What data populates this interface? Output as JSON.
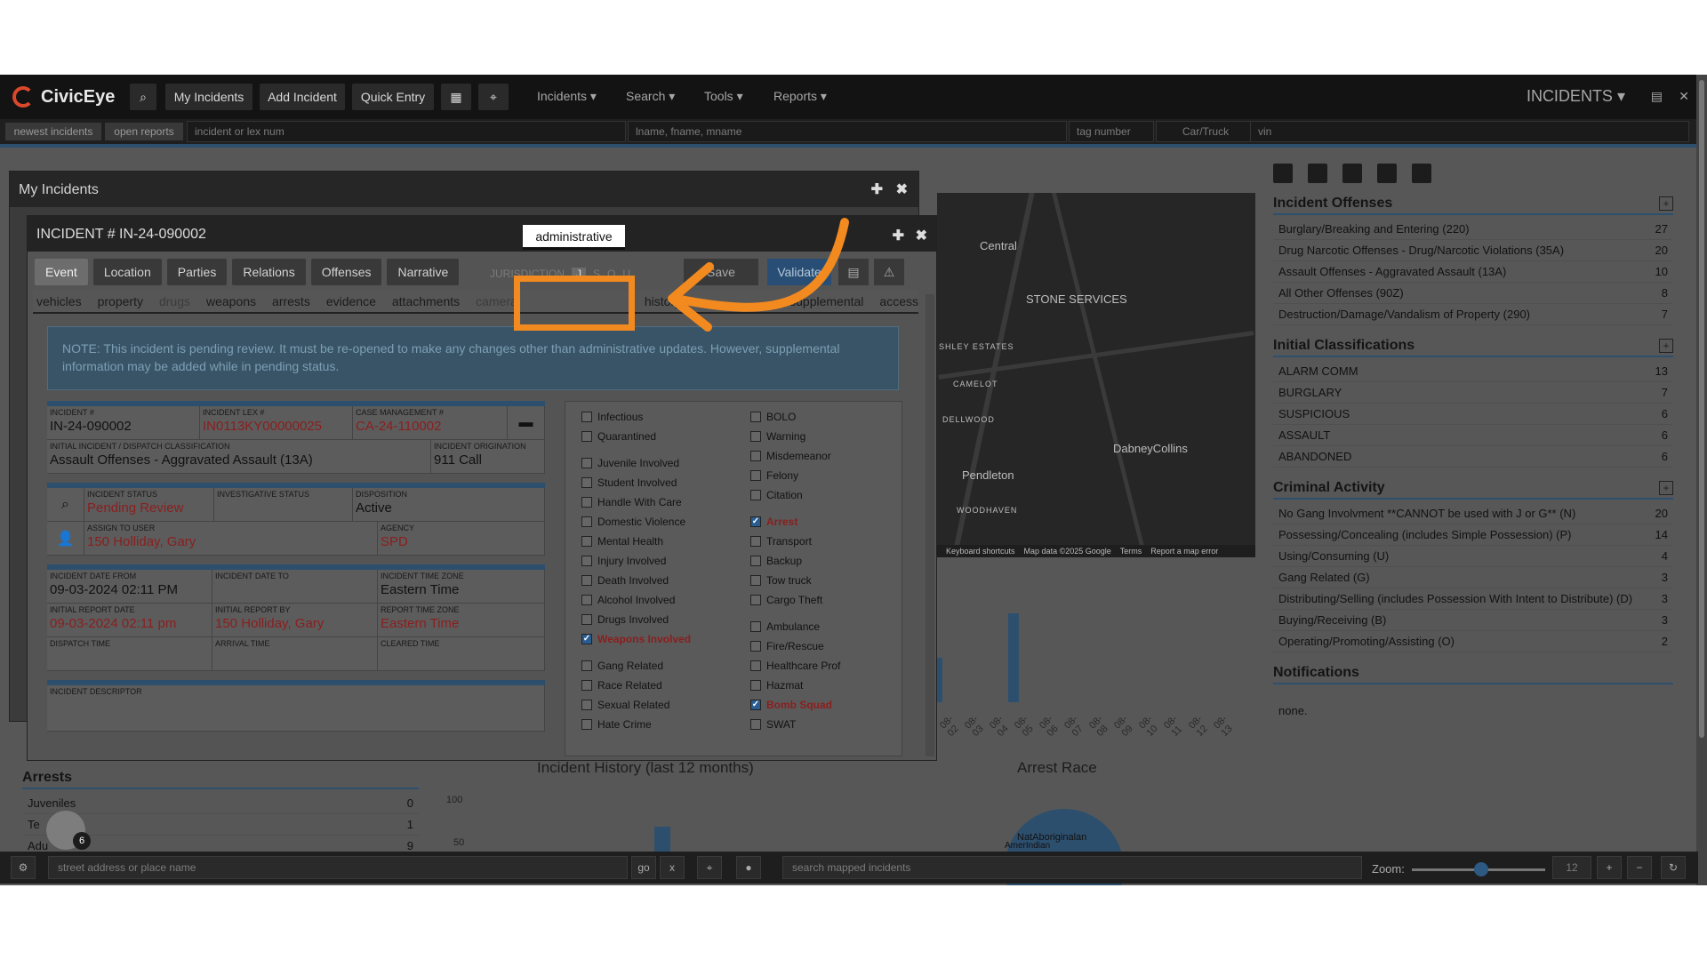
{
  "app": {
    "brand": "CivicEye",
    "nav_buttons": [
      "My Incidents",
      "Add Incident",
      "Quick Entry"
    ],
    "menus": [
      "Incidents",
      "Search",
      "Tools",
      "Reports"
    ],
    "module_title": "INCIDENTS"
  },
  "search": {
    "newest": "newest incidents",
    "open_reports": "open reports",
    "incident_placeholder": "incident or lex num",
    "name_placeholder": "lname, fname, mname",
    "tag_placeholder": "tag number",
    "vehicle_type": "Car/Truck",
    "vin_placeholder": "vin"
  },
  "dashboard": {
    "offenses": {
      "title": "Incident Offenses",
      "rows": [
        {
          "label": "Burglary/Breaking and Entering (220)",
          "count": "27"
        },
        {
          "label": "Drug Narcotic Offenses - Drug/Narcotic Violations (35A)",
          "count": "20"
        },
        {
          "label": "Assault Offenses - Aggravated Assault (13A)",
          "count": "10"
        },
        {
          "label": "All Other Offenses (90Z)",
          "count": "8"
        },
        {
          "label": "Destruction/Damage/Vandalism of Property (290)",
          "count": "7"
        }
      ]
    },
    "classifications": {
      "title": "Initial Classifications",
      "rows": [
        {
          "label": "ALARM COMM",
          "count": "13"
        },
        {
          "label": "BURGLARY",
          "count": "7"
        },
        {
          "label": "SUSPICIOUS",
          "count": "6"
        },
        {
          "label": "ASSAULT",
          "count": "6"
        },
        {
          "label": "ABANDONED",
          "count": "6"
        }
      ]
    },
    "criminal": {
      "title": "Criminal Activity",
      "rows": [
        {
          "label": "No Gang Involvment **CANNOT be used with J or G** (N)",
          "count": "20"
        },
        {
          "label": "Possessing/Concealing (includes Simple Possession) (P)",
          "count": "14"
        },
        {
          "label": "Using/Consuming (U)",
          "count": "4"
        },
        {
          "label": "Gang Related (G)",
          "count": "3"
        },
        {
          "label": "Distributing/Selling (includes Possession With Intent to Distribute) (D)",
          "count": "3"
        },
        {
          "label": "Buying/Receiving (B)",
          "count": "3"
        },
        {
          "label": "Operating/Promoting/Assisting (O)",
          "count": "2"
        }
      ]
    },
    "notifications": {
      "title": "Notifications",
      "text": "none."
    }
  },
  "map": {
    "labels": [
      "Central",
      "STONE SERVICES",
      "SHLEY ESTATES",
      "CAMELOT",
      "DELLWOOD",
      "DabneyCollins",
      "Pendleton",
      "WOODHAVEN"
    ],
    "footer": [
      "Keyboard shortcuts",
      "Map data ©2025 Google",
      "Terms",
      "Report a map error"
    ]
  },
  "charts": {
    "history_title": "Incident History (last 12 months)",
    "race_title": "Arrest Race",
    "axis_100": "100",
    "axis_50": "50",
    "race_label": "NatAboriginalan",
    "race_label2": "AmerIndian",
    "dates": [
      "08-02",
      "08-03",
      "08-04",
      "08-05",
      "08-06",
      "08-07",
      "08-08",
      "08-09",
      "08-10",
      "08-11",
      "08-12",
      "08-13"
    ]
  },
  "arrests": {
    "title": "Arrests",
    "rows": [
      {
        "label": "Juveniles",
        "count": "0"
      },
      {
        "label": "Te",
        "count": "1"
      },
      {
        "label": "Adu",
        "count": "9"
      }
    ]
  },
  "bottom": {
    "address_placeholder": "street address or place name",
    "go": "go",
    "x": "x",
    "mapped_placeholder": "search mapped incidents",
    "zoom_label": "Zoom:",
    "zoom_value": "12",
    "badge_count": "6"
  },
  "windows": {
    "back_title": "My Incidents",
    "front_title": "INCIDENT # IN-24-090002"
  },
  "incident": {
    "tabs": [
      "Event",
      "Location",
      "Parties",
      "Relations",
      "Offenses",
      "Narrative"
    ],
    "jurisdiction_label": "JURISDICTION",
    "jurisdiction": [
      "J",
      "S",
      "O",
      "U"
    ],
    "save": "Save",
    "validate": "Validate",
    "subtabs": [
      "vehicles",
      "property",
      "drugs",
      "weapons",
      "arrests",
      "evidence",
      "attachments",
      "camera",
      "administrative",
      "history",
      "supplemental",
      "access"
    ],
    "note": "NOTE: This incident is pending review. It must be re-opened to make any changes other than administrative updates. However, supplemental information may be added while in pending status.",
    "fields": {
      "incident_no_label": "INCIDENT #",
      "incident_no": "IN-24-090002",
      "lex_label": "INCIDENT LEX #",
      "lex": "IN0113KY00000025",
      "case_label": "CASE MANAGEMENT #",
      "case": "CA-24-110002",
      "initial_label": "INITIAL INCIDENT / DISPATCH CLASSIFICATION",
      "initial": "Assault Offenses - Aggravated Assault (13A)",
      "origination_label": "INCIDENT ORIGINATION",
      "origination": "911 Call",
      "status_label": "INCIDENT STATUS",
      "status": "Pending Review",
      "invest_label": "INVESTIGATIVE STATUS",
      "invest": "",
      "disposition_label": "DISPOSITION",
      "disposition": "Active",
      "assign_label": "ASSIGN TO USER",
      "assign": "150 Holliday, Gary",
      "agency_label": "AGENCY",
      "agency": "SPD",
      "date_from_label": "INCIDENT DATE FROM",
      "date_from": "09-03-2024 02:11 PM",
      "date_to_label": "INCIDENT DATE TO",
      "date_to": "",
      "tz_label": "INCIDENT TIME ZONE",
      "tz": "Eastern Time",
      "report_date_label": "INITIAL REPORT DATE",
      "report_date": "09-03-2024 02:11 pm",
      "report_by_label": "INITIAL REPORT BY",
      "report_by": "150 Holliday, Gary",
      "report_tz_label": "REPORT TIME ZONE",
      "report_tz": "Eastern Time",
      "dispatch_label": "DISPATCH TIME",
      "arrival_label": "ARRIVAL TIME",
      "cleared_label": "CLEARED TIME",
      "descriptor_label": "INCIDENT DESCRIPTOR"
    },
    "checks_left": [
      {
        "label": "Infectious",
        "on": false
      },
      {
        "label": "Quarantined",
        "on": false
      },
      {
        "label": "Juvenile Involved",
        "on": false
      },
      {
        "label": "Student Involved",
        "on": false
      },
      {
        "label": "Handle With Care",
        "on": false
      },
      {
        "label": "Domestic Violence",
        "on": false
      },
      {
        "label": "Mental Health",
        "on": false
      },
      {
        "label": "Injury Involved",
        "on": false
      },
      {
        "label": "Death Involved",
        "on": false
      },
      {
        "label": "Alcohol Involved",
        "on": false
      },
      {
        "label": "Drugs Involved",
        "on": false
      },
      {
        "label": "Weapons Involved",
        "on": true
      },
      {
        "label": "Gang Related",
        "on": false
      },
      {
        "label": "Race Related",
        "on": false
      },
      {
        "label": "Sexual Related",
        "on": false
      },
      {
        "label": "Hate Crime",
        "on": false
      }
    ],
    "checks_right": [
      {
        "label": "BOLO",
        "on": false
      },
      {
        "label": "Warning",
        "on": false
      },
      {
        "label": "Misdemeanor",
        "on": false
      },
      {
        "label": "Felony",
        "on": false
      },
      {
        "label": "Citation",
        "on": false
      },
      {
        "label": "Arrest",
        "on": true
      },
      {
        "label": "Transport",
        "on": false
      },
      {
        "label": "Backup",
        "on": false
      },
      {
        "label": "Tow truck",
        "on": false
      },
      {
        "label": "Cargo Theft",
        "on": false
      },
      {
        "label": "Ambulance",
        "on": false
      },
      {
        "label": "Fire/Rescue",
        "on": false
      },
      {
        "label": "Healthcare Prof",
        "on": false
      },
      {
        "label": "Hazmat",
        "on": false
      },
      {
        "label": "Bomb Squad",
        "on": true
      },
      {
        "label": "SWAT",
        "on": false
      }
    ]
  },
  "colors": {
    "accent": "#f38a1f",
    "brand_blue": "#2d4f6e",
    "alert_red": "#8b1e1e"
  }
}
